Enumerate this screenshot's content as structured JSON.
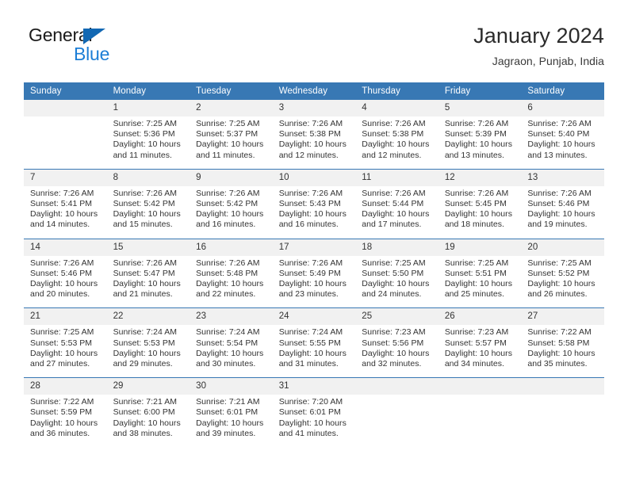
{
  "brand": {
    "name_part1": "General",
    "name_part2": "Blue",
    "accent_color": "#1c7ed6",
    "triangle_color": "#1268b3"
  },
  "header": {
    "title": "January 2024",
    "location": "Jagraon, Punjab, India"
  },
  "theme": {
    "header_row_color": "#3878b4",
    "daynum_band_color": "#f1f1f1",
    "text_color": "#333333"
  },
  "weekdays": [
    "Sunday",
    "Monday",
    "Tuesday",
    "Wednesday",
    "Thursday",
    "Friday",
    "Saturday"
  ],
  "weeks": [
    {
      "days": [
        {
          "num": "",
          "sunrise": "",
          "sunset": "",
          "daylight_line1": "",
          "daylight_line2": ""
        },
        {
          "num": "1",
          "sunrise": "Sunrise: 7:25 AM",
          "sunset": "Sunset: 5:36 PM",
          "daylight_line1": "Daylight: 10 hours",
          "daylight_line2": "and 11 minutes."
        },
        {
          "num": "2",
          "sunrise": "Sunrise: 7:25 AM",
          "sunset": "Sunset: 5:37 PM",
          "daylight_line1": "Daylight: 10 hours",
          "daylight_line2": "and 11 minutes."
        },
        {
          "num": "3",
          "sunrise": "Sunrise: 7:26 AM",
          "sunset": "Sunset: 5:38 PM",
          "daylight_line1": "Daylight: 10 hours",
          "daylight_line2": "and 12 minutes."
        },
        {
          "num": "4",
          "sunrise": "Sunrise: 7:26 AM",
          "sunset": "Sunset: 5:38 PM",
          "daylight_line1": "Daylight: 10 hours",
          "daylight_line2": "and 12 minutes."
        },
        {
          "num": "5",
          "sunrise": "Sunrise: 7:26 AM",
          "sunset": "Sunset: 5:39 PM",
          "daylight_line1": "Daylight: 10 hours",
          "daylight_line2": "and 13 minutes."
        },
        {
          "num": "6",
          "sunrise": "Sunrise: 7:26 AM",
          "sunset": "Sunset: 5:40 PM",
          "daylight_line1": "Daylight: 10 hours",
          "daylight_line2": "and 13 minutes."
        }
      ]
    },
    {
      "days": [
        {
          "num": "7",
          "sunrise": "Sunrise: 7:26 AM",
          "sunset": "Sunset: 5:41 PM",
          "daylight_line1": "Daylight: 10 hours",
          "daylight_line2": "and 14 minutes."
        },
        {
          "num": "8",
          "sunrise": "Sunrise: 7:26 AM",
          "sunset": "Sunset: 5:42 PM",
          "daylight_line1": "Daylight: 10 hours",
          "daylight_line2": "and 15 minutes."
        },
        {
          "num": "9",
          "sunrise": "Sunrise: 7:26 AM",
          "sunset": "Sunset: 5:42 PM",
          "daylight_line1": "Daylight: 10 hours",
          "daylight_line2": "and 16 minutes."
        },
        {
          "num": "10",
          "sunrise": "Sunrise: 7:26 AM",
          "sunset": "Sunset: 5:43 PM",
          "daylight_line1": "Daylight: 10 hours",
          "daylight_line2": "and 16 minutes."
        },
        {
          "num": "11",
          "sunrise": "Sunrise: 7:26 AM",
          "sunset": "Sunset: 5:44 PM",
          "daylight_line1": "Daylight: 10 hours",
          "daylight_line2": "and 17 minutes."
        },
        {
          "num": "12",
          "sunrise": "Sunrise: 7:26 AM",
          "sunset": "Sunset: 5:45 PM",
          "daylight_line1": "Daylight: 10 hours",
          "daylight_line2": "and 18 minutes."
        },
        {
          "num": "13",
          "sunrise": "Sunrise: 7:26 AM",
          "sunset": "Sunset: 5:46 PM",
          "daylight_line1": "Daylight: 10 hours",
          "daylight_line2": "and 19 minutes."
        }
      ]
    },
    {
      "days": [
        {
          "num": "14",
          "sunrise": "Sunrise: 7:26 AM",
          "sunset": "Sunset: 5:46 PM",
          "daylight_line1": "Daylight: 10 hours",
          "daylight_line2": "and 20 minutes."
        },
        {
          "num": "15",
          "sunrise": "Sunrise: 7:26 AM",
          "sunset": "Sunset: 5:47 PM",
          "daylight_line1": "Daylight: 10 hours",
          "daylight_line2": "and 21 minutes."
        },
        {
          "num": "16",
          "sunrise": "Sunrise: 7:26 AM",
          "sunset": "Sunset: 5:48 PM",
          "daylight_line1": "Daylight: 10 hours",
          "daylight_line2": "and 22 minutes."
        },
        {
          "num": "17",
          "sunrise": "Sunrise: 7:26 AM",
          "sunset": "Sunset: 5:49 PM",
          "daylight_line1": "Daylight: 10 hours",
          "daylight_line2": "and 23 minutes."
        },
        {
          "num": "18",
          "sunrise": "Sunrise: 7:25 AM",
          "sunset": "Sunset: 5:50 PM",
          "daylight_line1": "Daylight: 10 hours",
          "daylight_line2": "and 24 minutes."
        },
        {
          "num": "19",
          "sunrise": "Sunrise: 7:25 AM",
          "sunset": "Sunset: 5:51 PM",
          "daylight_line1": "Daylight: 10 hours",
          "daylight_line2": "and 25 minutes."
        },
        {
          "num": "20",
          "sunrise": "Sunrise: 7:25 AM",
          "sunset": "Sunset: 5:52 PM",
          "daylight_line1": "Daylight: 10 hours",
          "daylight_line2": "and 26 minutes."
        }
      ]
    },
    {
      "days": [
        {
          "num": "21",
          "sunrise": "Sunrise: 7:25 AM",
          "sunset": "Sunset: 5:53 PM",
          "daylight_line1": "Daylight: 10 hours",
          "daylight_line2": "and 27 minutes."
        },
        {
          "num": "22",
          "sunrise": "Sunrise: 7:24 AM",
          "sunset": "Sunset: 5:53 PM",
          "daylight_line1": "Daylight: 10 hours",
          "daylight_line2": "and 29 minutes."
        },
        {
          "num": "23",
          "sunrise": "Sunrise: 7:24 AM",
          "sunset": "Sunset: 5:54 PM",
          "daylight_line1": "Daylight: 10 hours",
          "daylight_line2": "and 30 minutes."
        },
        {
          "num": "24",
          "sunrise": "Sunrise: 7:24 AM",
          "sunset": "Sunset: 5:55 PM",
          "daylight_line1": "Daylight: 10 hours",
          "daylight_line2": "and 31 minutes."
        },
        {
          "num": "25",
          "sunrise": "Sunrise: 7:23 AM",
          "sunset": "Sunset: 5:56 PM",
          "daylight_line1": "Daylight: 10 hours",
          "daylight_line2": "and 32 minutes."
        },
        {
          "num": "26",
          "sunrise": "Sunrise: 7:23 AM",
          "sunset": "Sunset: 5:57 PM",
          "daylight_line1": "Daylight: 10 hours",
          "daylight_line2": "and 34 minutes."
        },
        {
          "num": "27",
          "sunrise": "Sunrise: 7:22 AM",
          "sunset": "Sunset: 5:58 PM",
          "daylight_line1": "Daylight: 10 hours",
          "daylight_line2": "and 35 minutes."
        }
      ]
    },
    {
      "days": [
        {
          "num": "28",
          "sunrise": "Sunrise: 7:22 AM",
          "sunset": "Sunset: 5:59 PM",
          "daylight_line1": "Daylight: 10 hours",
          "daylight_line2": "and 36 minutes."
        },
        {
          "num": "29",
          "sunrise": "Sunrise: 7:21 AM",
          "sunset": "Sunset: 6:00 PM",
          "daylight_line1": "Daylight: 10 hours",
          "daylight_line2": "and 38 minutes."
        },
        {
          "num": "30",
          "sunrise": "Sunrise: 7:21 AM",
          "sunset": "Sunset: 6:01 PM",
          "daylight_line1": "Daylight: 10 hours",
          "daylight_line2": "and 39 minutes."
        },
        {
          "num": "31",
          "sunrise": "Sunrise: 7:20 AM",
          "sunset": "Sunset: 6:01 PM",
          "daylight_line1": "Daylight: 10 hours",
          "daylight_line2": "and 41 minutes."
        },
        {
          "num": "",
          "sunrise": "",
          "sunset": "",
          "daylight_line1": "",
          "daylight_line2": ""
        },
        {
          "num": "",
          "sunrise": "",
          "sunset": "",
          "daylight_line1": "",
          "daylight_line2": ""
        },
        {
          "num": "",
          "sunrise": "",
          "sunset": "",
          "daylight_line1": "",
          "daylight_line2": ""
        }
      ]
    }
  ]
}
